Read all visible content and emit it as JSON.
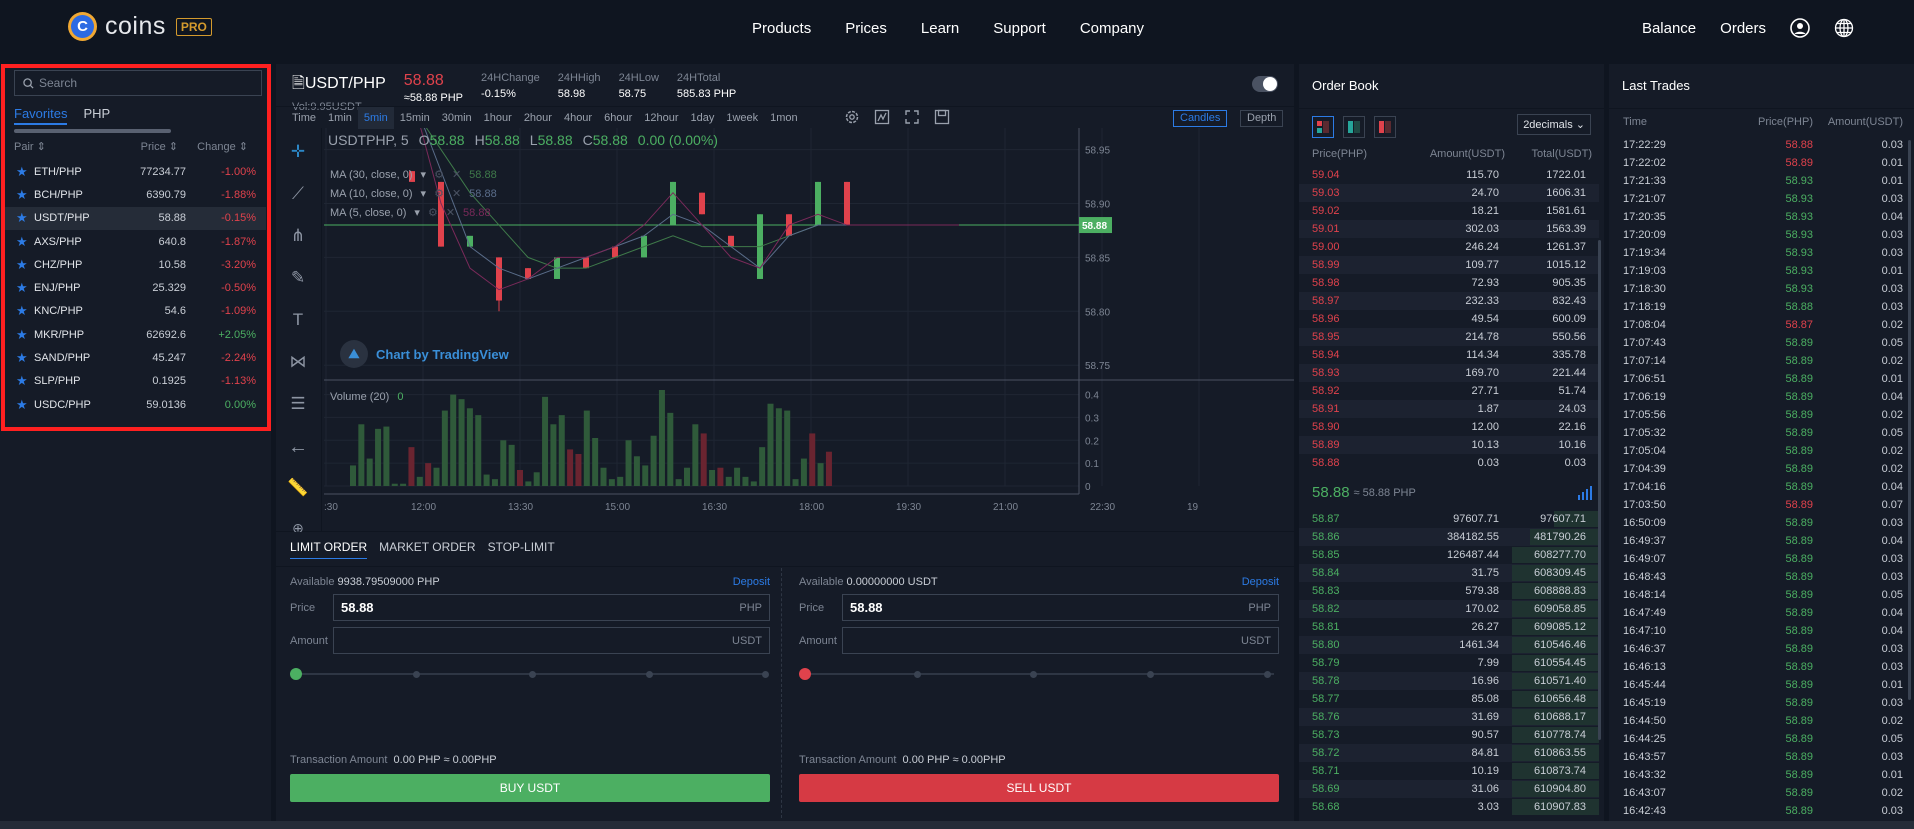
{
  "brand": {
    "name": "coins",
    "badge": "PRO",
    "logo_letter": "C"
  },
  "nav": {
    "items": [
      "Products",
      "Prices",
      "Learn",
      "Support",
      "Company"
    ],
    "right": [
      "Balance",
      "Orders"
    ]
  },
  "market_list": {
    "search_placeholder": "Search",
    "tabs": [
      "Favorites",
      "PHP"
    ],
    "active_tab": "Favorites",
    "headers": [
      "Pair",
      "Price",
      "Change"
    ],
    "rows": [
      {
        "pair": "ETH/PHP",
        "price": "77234.77",
        "change": "-1.00%",
        "dir": "down"
      },
      {
        "pair": "BCH/PHP",
        "price": "6390.79",
        "change": "-1.88%",
        "dir": "down"
      },
      {
        "pair": "USDT/PHP",
        "price": "58.88",
        "change": "-0.15%",
        "dir": "down",
        "selected": true
      },
      {
        "pair": "AXS/PHP",
        "price": "640.8",
        "change": "-1.87%",
        "dir": "down"
      },
      {
        "pair": "CHZ/PHP",
        "price": "10.58",
        "change": "-3.20%",
        "dir": "down"
      },
      {
        "pair": "ENJ/PHP",
        "price": "25.329",
        "change": "-0.50%",
        "dir": "down"
      },
      {
        "pair": "KNC/PHP",
        "price": "54.6",
        "change": "-1.09%",
        "dir": "down"
      },
      {
        "pair": "MKR/PHP",
        "price": "62692.6",
        "change": "+2.05%",
        "dir": "up"
      },
      {
        "pair": "SAND/PHP",
        "price": "45.247",
        "change": "-2.24%",
        "dir": "down"
      },
      {
        "pair": "SLP/PHP",
        "price": "0.1925",
        "change": "-1.13%",
        "dir": "down"
      },
      {
        "pair": "USDC/PHP",
        "price": "59.0136",
        "change": "0.00%",
        "dir": "up"
      }
    ]
  },
  "ticker": {
    "symbol": "USDT/PHP",
    "volume": "Vol:9.95USDT",
    "last": "58.88",
    "approx": "≈58.88 PHP",
    "stats": [
      {
        "label": "24HChange",
        "value": "-0.15%",
        "dir": "down"
      },
      {
        "label": "24HHigh",
        "value": "58.98"
      },
      {
        "label": "24HLow",
        "value": "58.75"
      },
      {
        "label": "24HTotal",
        "value": "585.83 PHP"
      }
    ]
  },
  "timeframes": {
    "items": [
      "Time",
      "1min",
      "5min",
      "15min",
      "30min",
      "1hour",
      "2hour",
      "4hour",
      "6hour",
      "12hour",
      "1day",
      "1week",
      "1mon"
    ],
    "active": "5min",
    "views": [
      "Candles",
      "Depth"
    ],
    "active_view": "Candles"
  },
  "chart_data": {
    "type": "candlestick",
    "legend": {
      "symbol": "USDTPHP, 5",
      "o": "58.88",
      "h": "58.88",
      "l": "58.88",
      "c": "58.88",
      "change": "0.00 (0.00%)"
    },
    "indicators": [
      {
        "label": "MA (30, close, 0)",
        "value": "58.88",
        "color": "#3f7a4a"
      },
      {
        "label": "MA (10, close, 0)",
        "value": "58.88",
        "color": "#5a6d8a"
      },
      {
        "label": "MA (5, close, 0)",
        "value": "58.88",
        "color": "#7a2a5a"
      }
    ],
    "watermark": "Chart by TradingView",
    "price_axis": {
      "ticks": [
        "58.95",
        "58.90",
        "58.85",
        "58.80",
        "58.75"
      ],
      "range": [
        58.74,
        58.97
      ],
      "last": "58.88"
    },
    "volume": {
      "label": "Volume (20)",
      "value": "0",
      "ticks": [
        "0.4",
        "0.3",
        "0.2",
        "0.1",
        "0"
      ],
      "range": [
        0,
        0.42
      ]
    },
    "x_ticks": [
      ":30",
      "12:00",
      "13:30",
      "15:00",
      "16:30",
      "18:00",
      "19:30",
      "21:00",
      "22:30",
      "19"
    ],
    "candles": [
      {
        "o": 58.93,
        "c": 58.92,
        "h": 58.93,
        "l": 58.92
      },
      {
        "o": 58.92,
        "c": 58.86,
        "h": 58.92,
        "l": 58.86
      },
      {
        "o": 58.86,
        "c": 58.87,
        "h": 58.87,
        "l": 58.86
      },
      {
        "o": 58.85,
        "c": 58.81,
        "h": 58.85,
        "l": 58.8
      },
      {
        "o": 58.84,
        "c": 58.83,
        "h": 58.84,
        "l": 58.83
      },
      {
        "o": 58.83,
        "c": 58.85,
        "h": 58.85,
        "l": 58.83
      },
      {
        "o": 58.85,
        "c": 58.84,
        "h": 58.85,
        "l": 58.84
      },
      {
        "o": 58.86,
        "c": 58.85,
        "h": 58.86,
        "l": 58.85
      },
      {
        "o": 58.85,
        "c": 58.87,
        "h": 58.87,
        "l": 58.85
      },
      {
        "o": 58.88,
        "c": 58.92,
        "h": 58.92,
        "l": 58.88
      },
      {
        "o": 58.91,
        "c": 58.89,
        "h": 58.91,
        "l": 58.89
      },
      {
        "o": 58.87,
        "c": 58.86,
        "h": 58.87,
        "l": 58.86
      },
      {
        "o": 58.83,
        "c": 58.89,
        "h": 58.89,
        "l": 58.83
      },
      {
        "o": 58.89,
        "c": 58.87,
        "h": 58.89,
        "l": 58.87
      },
      {
        "o": 58.88,
        "c": 58.92,
        "h": 58.92,
        "l": 58.88
      },
      {
        "o": 58.92,
        "c": 58.88,
        "h": 58.92,
        "l": 58.88
      }
    ],
    "volumes": [
      {
        "v": 0.09,
        "dir": "up"
      },
      {
        "v": 0.27,
        "dir": "up"
      },
      {
        "v": 0.12,
        "dir": "up"
      },
      {
        "v": 0.25,
        "dir": "up"
      },
      {
        "v": 0.26,
        "dir": "up"
      },
      {
        "v": 0.01,
        "dir": "up"
      },
      {
        "v": 0.01,
        "dir": "up"
      },
      {
        "v": 0.17,
        "dir": "down"
      },
      {
        "v": 0.04,
        "dir": "up"
      },
      {
        "v": 0.1,
        "dir": "down"
      },
      {
        "v": 0.08,
        "dir": "up"
      },
      {
        "v": 0.33,
        "dir": "up"
      },
      {
        "v": 0.4,
        "dir": "up"
      },
      {
        "v": 0.38,
        "dir": "up"
      },
      {
        "v": 0.34,
        "dir": "up"
      },
      {
        "v": 0.31,
        "dir": "up"
      },
      {
        "v": 0.05,
        "dir": "up"
      },
      {
        "v": 0.03,
        "dir": "up"
      },
      {
        "v": 0.2,
        "dir": "up"
      },
      {
        "v": 0.18,
        "dir": "up"
      },
      {
        "v": 0.07,
        "dir": "down"
      },
      {
        "v": 0.02,
        "dir": "up"
      },
      {
        "v": 0.06,
        "dir": "up"
      },
      {
        "v": 0.39,
        "dir": "up"
      },
      {
        "v": 0.27,
        "dir": "up"
      },
      {
        "v": 0.31,
        "dir": "up"
      },
      {
        "v": 0.16,
        "dir": "down"
      },
      {
        "v": 0.14,
        "dir": "down"
      },
      {
        "v": 0.33,
        "dir": "up"
      },
      {
        "v": 0.21,
        "dir": "up"
      },
      {
        "v": 0.08,
        "dir": "up"
      },
      {
        "v": 0.03,
        "dir": "up"
      },
      {
        "v": 0.04,
        "dir": "up"
      },
      {
        "v": 0.2,
        "dir": "up"
      },
      {
        "v": 0.13,
        "dir": "up"
      },
      {
        "v": 0.09,
        "dir": "up"
      },
      {
        "v": 0.22,
        "dir": "up"
      },
      {
        "v": 0.42,
        "dir": "up"
      },
      {
        "v": 0.32,
        "dir": "up"
      },
      {
        "v": 0.03,
        "dir": "up"
      },
      {
        "v": 0.08,
        "dir": "up"
      },
      {
        "v": 0.27,
        "dir": "up"
      },
      {
        "v": 0.23,
        "dir": "down"
      },
      {
        "v": 0.07,
        "dir": "up"
      },
      {
        "v": 0.08,
        "dir": "down"
      },
      {
        "v": 0.04,
        "dir": "up"
      },
      {
        "v": 0.08,
        "dir": "up"
      },
      {
        "v": 0.04,
        "dir": "up"
      },
      {
        "v": 0.02,
        "dir": "up"
      },
      {
        "v": 0.17,
        "dir": "up"
      },
      {
        "v": 0.36,
        "dir": "up"
      },
      {
        "v": 0.34,
        "dir": "up"
      },
      {
        "v": 0.33,
        "dir": "up"
      },
      {
        "v": 0.03,
        "dir": "up"
      },
      {
        "v": 0.12,
        "dir": "up"
      },
      {
        "v": 0.23,
        "dir": "down"
      },
      {
        "v": 0.1,
        "dir": "up"
      },
      {
        "v": 0.15,
        "dir": "down"
      }
    ]
  },
  "order_form": {
    "tabs": [
      "LIMIT ORDER",
      "MARKET ORDER",
      "STOP-LIMIT"
    ],
    "active_tab": "LIMIT ORDER",
    "buy": {
      "available_label": "Available",
      "available": "9938.79509000 PHP",
      "deposit": "Deposit",
      "price_label": "Price",
      "price": "58.88",
      "price_unit": "PHP",
      "amount_label": "Amount",
      "amount": "",
      "amount_unit": "USDT",
      "slider_pct": 0,
      "tx_label": "Transaction Amount",
      "tx_value": "0.00 PHP ≈ 0.00PHP",
      "button": "BUY USDT"
    },
    "sell": {
      "available_label": "Available",
      "available": "0.00000000 USDT",
      "deposit": "Deposit",
      "price_label": "Price",
      "price": "58.88",
      "price_unit": "PHP",
      "amount_label": "Amount",
      "amount": "",
      "amount_unit": "USDT",
      "slider_pct": 0,
      "tx_label": "Transaction Amount",
      "tx_value": "0.00 PHP ≈ 0.00PHP",
      "button": "SELL USDT"
    }
  },
  "order_book": {
    "title": "Order Book",
    "decimals": "2decimals",
    "headers": [
      "Price(PHP)",
      "Amount(USDT)",
      "Total(USDT)"
    ],
    "asks": [
      [
        "59.04",
        "115.70",
        "1722.01"
      ],
      [
        "59.03",
        "24.70",
        "1606.31"
      ],
      [
        "59.02",
        "18.21",
        "1581.61"
      ],
      [
        "59.01",
        "302.03",
        "1563.39"
      ],
      [
        "59.00",
        "246.24",
        "1261.37"
      ],
      [
        "58.99",
        "109.77",
        "1015.12"
      ],
      [
        "58.98",
        "72.93",
        "905.35"
      ],
      [
        "58.97",
        "232.33",
        "832.43"
      ],
      [
        "58.96",
        "49.54",
        "600.09"
      ],
      [
        "58.95",
        "214.78",
        "550.56"
      ],
      [
        "58.94",
        "114.34",
        "335.78"
      ],
      [
        "58.93",
        "169.70",
        "221.44"
      ],
      [
        "58.92",
        "27.71",
        "51.74"
      ],
      [
        "58.91",
        "1.87",
        "24.03"
      ],
      [
        "58.90",
        "12.00",
        "22.16"
      ],
      [
        "58.89",
        "10.13",
        "10.16"
      ],
      [
        "58.88",
        "0.03",
        "0.03"
      ]
    ],
    "mid": {
      "price": "58.88",
      "approx": "≈ 58.88 PHP"
    },
    "bids": [
      [
        "58.87",
        "97607.71",
        "97607.71"
      ],
      [
        "58.86",
        "384182.55",
        "481790.26"
      ],
      [
        "58.85",
        "126487.44",
        "608277.70"
      ],
      [
        "58.84",
        "31.75",
        "608309.45"
      ],
      [
        "58.83",
        "579.38",
        "608888.83"
      ],
      [
        "58.82",
        "170.02",
        "609058.85"
      ],
      [
        "58.81",
        "26.27",
        "609085.12"
      ],
      [
        "58.80",
        "1461.34",
        "610546.46"
      ],
      [
        "58.79",
        "7.99",
        "610554.45"
      ],
      [
        "58.78",
        "16.96",
        "610571.40"
      ],
      [
        "58.77",
        "85.08",
        "610656.48"
      ],
      [
        "58.76",
        "31.69",
        "610688.17"
      ],
      [
        "58.73",
        "90.57",
        "610778.74"
      ],
      [
        "58.72",
        "84.81",
        "610863.55"
      ],
      [
        "58.71",
        "10.19",
        "610873.74"
      ],
      [
        "58.69",
        "31.06",
        "610904.80"
      ],
      [
        "58.68",
        "3.03",
        "610907.83"
      ]
    ]
  },
  "last_trades": {
    "title": "Last Trades",
    "headers": [
      "Time",
      "Price(PHP)",
      "Amount(USDT)"
    ],
    "rows": [
      [
        "17:22:29",
        "58.88",
        "0.03",
        "down"
      ],
      [
        "17:22:02",
        "58.89",
        "0.01",
        "down"
      ],
      [
        "17:21:33",
        "58.93",
        "0.01",
        "up"
      ],
      [
        "17:21:07",
        "58.93",
        "0.03",
        "up"
      ],
      [
        "17:20:35",
        "58.93",
        "0.04",
        "up"
      ],
      [
        "17:20:09",
        "58.93",
        "0.03",
        "up"
      ],
      [
        "17:19:34",
        "58.93",
        "0.03",
        "up"
      ],
      [
        "17:19:03",
        "58.93",
        "0.01",
        "up"
      ],
      [
        "17:18:30",
        "58.93",
        "0.03",
        "up"
      ],
      [
        "17:18:19",
        "58.88",
        "0.03",
        "up"
      ],
      [
        "17:08:04",
        "58.87",
        "0.02",
        "down"
      ],
      [
        "17:07:43",
        "58.89",
        "0.05",
        "up"
      ],
      [
        "17:07:14",
        "58.89",
        "0.02",
        "up"
      ],
      [
        "17:06:51",
        "58.89",
        "0.01",
        "up"
      ],
      [
        "17:06:19",
        "58.89",
        "0.04",
        "up"
      ],
      [
        "17:05:56",
        "58.89",
        "0.02",
        "up"
      ],
      [
        "17:05:32",
        "58.89",
        "0.05",
        "up"
      ],
      [
        "17:05:04",
        "58.89",
        "0.02",
        "up"
      ],
      [
        "17:04:39",
        "58.89",
        "0.02",
        "up"
      ],
      [
        "17:04:16",
        "58.89",
        "0.04",
        "up"
      ],
      [
        "17:03:50",
        "58.89",
        "0.07",
        "down"
      ],
      [
        "16:50:09",
        "58.89",
        "0.03",
        "up"
      ],
      [
        "16:49:37",
        "58.89",
        "0.04",
        "up"
      ],
      [
        "16:49:07",
        "58.89",
        "0.03",
        "up"
      ],
      [
        "16:48:43",
        "58.89",
        "0.03",
        "up"
      ],
      [
        "16:48:14",
        "58.89",
        "0.05",
        "up"
      ],
      [
        "16:47:49",
        "58.89",
        "0.04",
        "up"
      ],
      [
        "16:47:10",
        "58.89",
        "0.04",
        "up"
      ],
      [
        "16:46:37",
        "58.89",
        "0.03",
        "up"
      ],
      [
        "16:46:13",
        "58.89",
        "0.03",
        "up"
      ],
      [
        "16:45:44",
        "58.89",
        "0.01",
        "up"
      ],
      [
        "16:45:19",
        "58.89",
        "0.03",
        "up"
      ],
      [
        "16:44:50",
        "58.89",
        "0.02",
        "up"
      ],
      [
        "16:44:25",
        "58.89",
        "0.05",
        "up"
      ],
      [
        "16:43:57",
        "58.89",
        "0.03",
        "up"
      ],
      [
        "16:43:32",
        "58.89",
        "0.01",
        "up"
      ],
      [
        "16:43:07",
        "58.89",
        "0.02",
        "up"
      ],
      [
        "16:42:43",
        "58.89",
        "0.03",
        "up"
      ]
    ]
  },
  "colors": {
    "up": "#4caf62",
    "down": "#e0424c",
    "accent": "#2c7be5",
    "brand": "#f0a833"
  }
}
